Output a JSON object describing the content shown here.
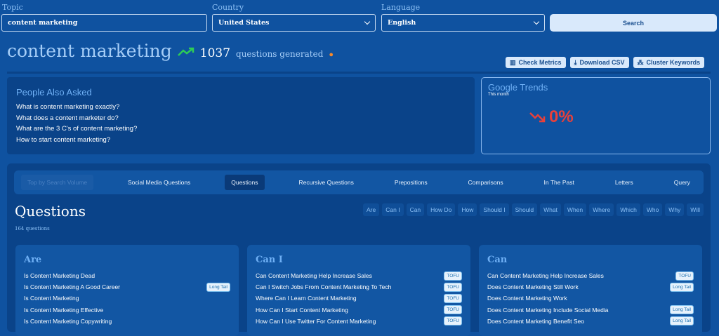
{
  "form": {
    "topic_label": "Topic",
    "topic_value": "content marketing",
    "country_label": "Country",
    "country_value": "United States",
    "language_label": "Language",
    "language_value": "English",
    "search_label": "Search"
  },
  "header": {
    "title": "content marketing",
    "count": "1037",
    "count_suffix": "questions generated",
    "buttons": [
      "Check Metrics",
      "Download CSV",
      "Cluster Keywords"
    ]
  },
  "paa": {
    "title": "People Also Asked",
    "questions": [
      "What is content marketing exactly?",
      "What does a content marketer do?",
      "What are the 3 C's of content marketing?",
      "How to start content marketing?"
    ]
  },
  "trends": {
    "title": "Google Trends",
    "period": "This month",
    "value": "0%",
    "color": "#e8403a"
  },
  "tabs": [
    "Top by Search Volume",
    "Social Media Questions",
    "Questions",
    "Recursive Questions",
    "Prepositions",
    "Comparisons",
    "In The Past",
    "Letters",
    "Query"
  ],
  "section": {
    "title": "Questions",
    "count": "164 questions",
    "chips": [
      "Are",
      "Can I",
      "Can",
      "How Do",
      "How",
      "Should I",
      "Should",
      "What",
      "When",
      "Where",
      "Which",
      "Who",
      "Why",
      "Will"
    ]
  },
  "cards": [
    {
      "title": "Are",
      "items": [
        {
          "text": "Is Content Marketing Dead",
          "badge": ""
        },
        {
          "text": "Is Content Marketing A Good Career",
          "badge": "Long Tail"
        },
        {
          "text": "Is Content Marketing",
          "badge": ""
        },
        {
          "text": "Is Content Marketing Effective",
          "badge": ""
        },
        {
          "text": "Is Content Marketing Copywriting",
          "badge": ""
        }
      ]
    },
    {
      "title": "Can I",
      "items": [
        {
          "text": "Can Content Marketing Help Increase Sales",
          "badge": "TOFU"
        },
        {
          "text": "Can I Switch Jobs From Content Marketing To Tech",
          "badge": "TOFU"
        },
        {
          "text": "Where Can I Learn Content Marketing",
          "badge": "TOFU"
        },
        {
          "text": "How Can I Start Content Marketing",
          "badge": "TOFU"
        },
        {
          "text": "How Can I Use Twitter For Content Marketing",
          "badge": "TOFU"
        }
      ]
    },
    {
      "title": "Can",
      "items": [
        {
          "text": "Can Content Marketing Help Increase Sales",
          "badge": "TOFU"
        },
        {
          "text": "Does Content Marketing Still Work",
          "badge": "Long Tail"
        },
        {
          "text": "Does Content Marketing Work",
          "badge": ""
        },
        {
          "text": "Does Content Marketing Include Social Media",
          "badge": "Long Tail"
        },
        {
          "text": "Does Content Marketing Benefit Seo",
          "badge": "Long Tail"
        }
      ]
    }
  ]
}
